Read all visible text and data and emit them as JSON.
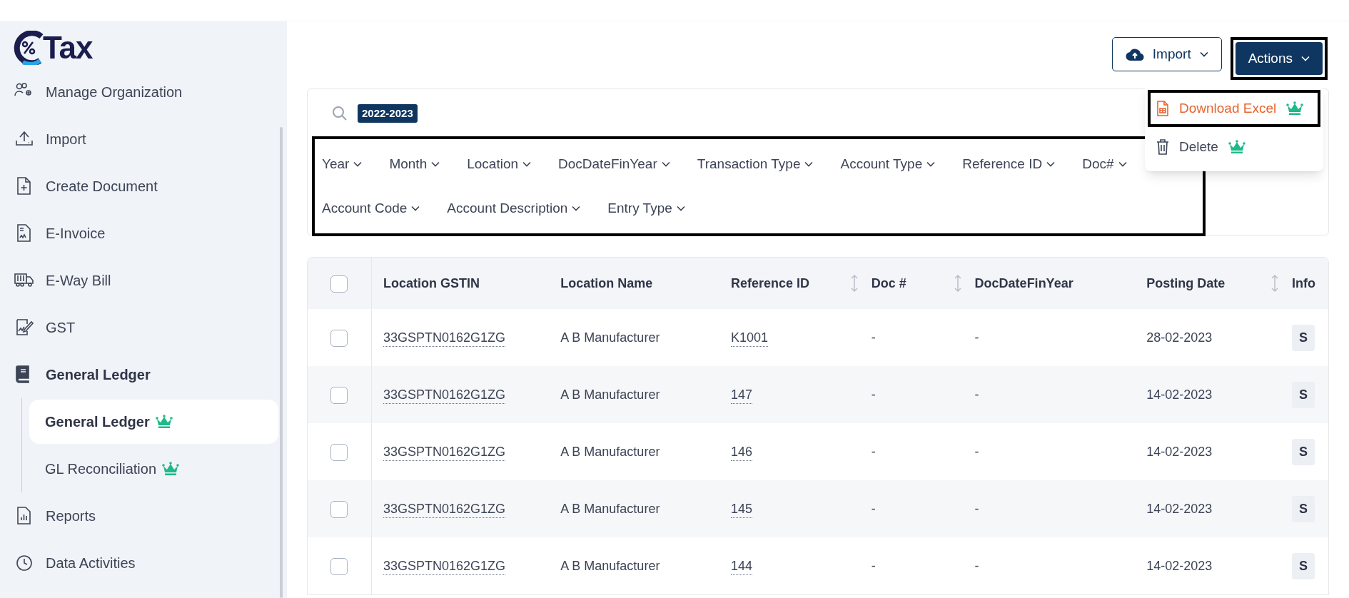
{
  "logo": {
    "text": "Tax"
  },
  "sidebar": {
    "items": [
      {
        "label": "Manage Organization",
        "selected": false
      },
      {
        "label": "Import",
        "selected": false
      },
      {
        "label": "Create Document",
        "selected": false
      },
      {
        "label": "E-Invoice",
        "selected": false
      },
      {
        "label": "E-Way Bill",
        "selected": false
      },
      {
        "label": "GST",
        "selected": false
      },
      {
        "label": "General Ledger",
        "selected": true,
        "children": [
          {
            "label": "General Ledger",
            "premium": true,
            "selected": true
          },
          {
            "label": "GL Reconciliation",
            "premium": true,
            "selected": false
          }
        ]
      },
      {
        "label": "Reports",
        "selected": false
      },
      {
        "label": "Data Activities",
        "selected": false
      }
    ]
  },
  "toolbar": {
    "import_button": "Import",
    "actions_button": "Actions"
  },
  "actions_menu": [
    {
      "label": "Download Excel",
      "kind": "excel",
      "premium": true,
      "highlighted": true
    },
    {
      "label": "Delete",
      "kind": "delete",
      "premium": true,
      "highlighted": false
    }
  ],
  "search": {
    "chips": [
      "2022-2023"
    ]
  },
  "filters": [
    "Year",
    "Month",
    "Location",
    "DocDateFinYear",
    "Transaction Type",
    "Account Type",
    "Reference ID",
    "Doc#",
    "Account Code",
    "Account Description",
    "Entry Type"
  ],
  "table": {
    "all_checked": false,
    "columns": [
      {
        "label": "Location GSTIN",
        "sortable": false
      },
      {
        "label": "Location Name",
        "sortable": false
      },
      {
        "label": "Reference ID",
        "sortable": true
      },
      {
        "label": "Doc #",
        "sortable": true
      },
      {
        "label": "DocDateFinYear",
        "sortable": false
      },
      {
        "label": "Posting Date",
        "sortable": true
      },
      {
        "label": "Info",
        "sortable": false
      }
    ],
    "rows": [
      {
        "checked": false,
        "cells": [
          "33GSPTN0162G1ZG",
          "A B Manufacturer",
          "K1001",
          "-",
          "-",
          "28-02-2023",
          "S"
        ]
      },
      {
        "checked": false,
        "cells": [
          "33GSPTN0162G1ZG",
          "A B Manufacturer",
          "147",
          "-",
          "-",
          "14-02-2023",
          "S"
        ]
      },
      {
        "checked": false,
        "cells": [
          "33GSPTN0162G1ZG",
          "A B Manufacturer",
          "146",
          "-",
          "-",
          "14-02-2023",
          "S"
        ]
      },
      {
        "checked": false,
        "cells": [
          "33GSPTN0162G1ZG",
          "A B Manufacturer",
          "145",
          "-",
          "-",
          "14-02-2023",
          "S"
        ]
      },
      {
        "checked": false,
        "cells": [
          "33GSPTN0162G1ZG",
          "A B Manufacturer",
          "144",
          "-",
          "-",
          "14-02-2023",
          "S"
        ]
      }
    ]
  }
}
